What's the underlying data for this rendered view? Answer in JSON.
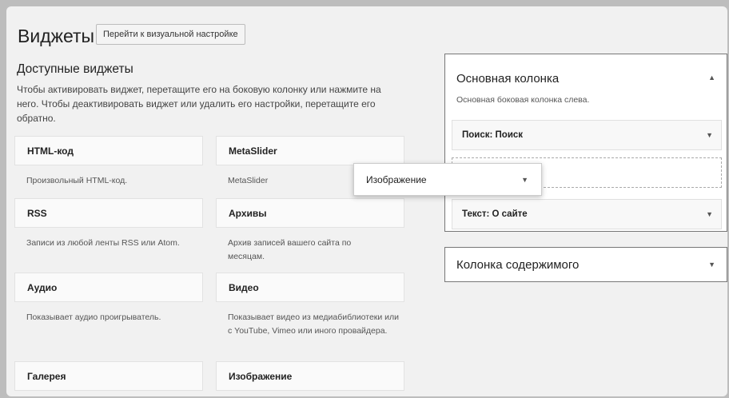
{
  "page": {
    "title": "Виджеты",
    "visual_button": "Перейти к визуальной настройке"
  },
  "available": {
    "title": "Доступные виджеты",
    "description": "Чтобы активировать виджет, перетащите его на боковую колонку или нажмите на него. Чтобы деактивировать виджет или удалить его настройки, перетащите его обратно.",
    "widgets": [
      {
        "name": "HTML-код",
        "desc": "Произвольный HTML-код."
      },
      {
        "name": "MetaSlider",
        "desc": "MetaSlider"
      },
      {
        "name": "RSS",
        "desc": "Записи из любой ленты RSS или Atom."
      },
      {
        "name": "Архивы",
        "desc": "Архив записей вашего сайта по месяцам."
      },
      {
        "name": "Аудио",
        "desc": "Показывает аудио проигрыватель."
      },
      {
        "name": "Видео",
        "desc": "Показывает видео из медиабиблиотеки или с YouTube, Vimeo или иного провайдера."
      },
      {
        "name": "Галерея",
        "desc": ""
      },
      {
        "name": "Изображение",
        "desc": ""
      }
    ]
  },
  "main_sidebar": {
    "title": "Основная колонка",
    "description": "Основная боковая колонка слева.",
    "widgets": [
      {
        "label": "Поиск: Поиск"
      },
      {
        "label": "Текст: О сайте"
      }
    ]
  },
  "dragging_widget": {
    "label": "Изображение"
  },
  "content_sidebar": {
    "title": "Колонка содержимого"
  },
  "icons": {
    "collapse": "triangle-up-icon",
    "expand": "triangle-down-icon"
  }
}
